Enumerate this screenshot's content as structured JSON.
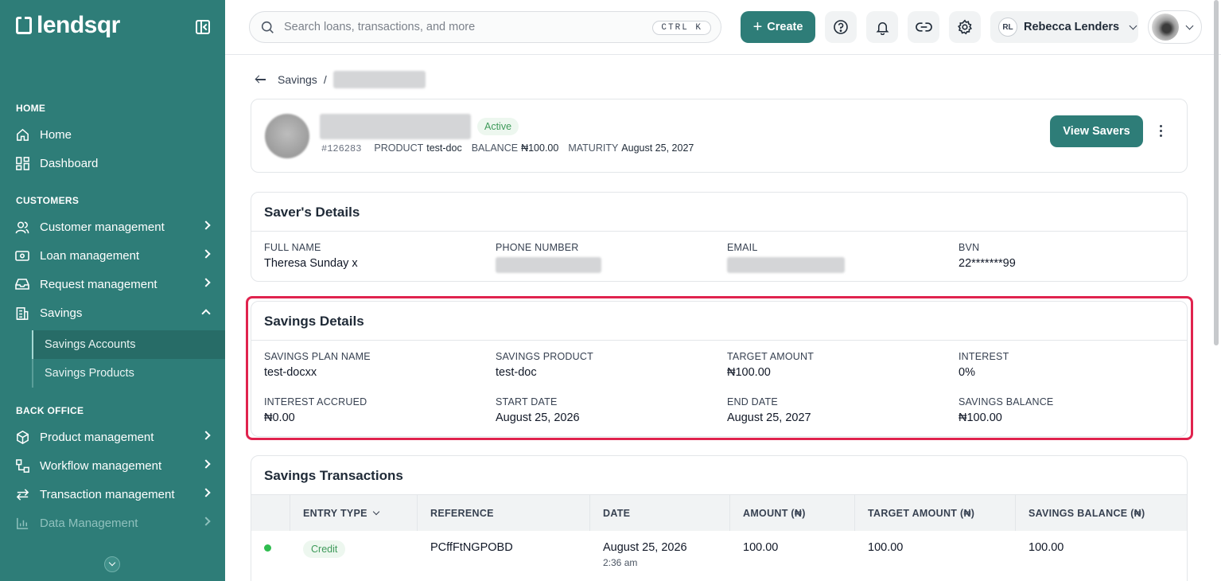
{
  "app": {
    "logo_text": "lendsqr"
  },
  "sidebar": {
    "sections": [
      {
        "title": "HOME"
      },
      {
        "title": "CUSTOMERS"
      },
      {
        "title": "BACK OFFICE"
      }
    ],
    "items": [
      {
        "label": "Home",
        "icon": "home-icon"
      },
      {
        "label": "Dashboard",
        "icon": "dashboard-icon"
      },
      {
        "label": "Customer management",
        "icon": "users-icon"
      },
      {
        "label": "Loan management",
        "icon": "loan-icon"
      },
      {
        "label": "Request management",
        "icon": "inbox-icon"
      },
      {
        "label": "Savings",
        "icon": "savings-icon"
      },
      {
        "label": "Product management",
        "icon": "box-icon"
      },
      {
        "label": "Workflow management",
        "icon": "workflow-icon"
      },
      {
        "label": "Transaction management",
        "icon": "transfer-icon"
      },
      {
        "label": "Data Management",
        "icon": "chart-icon"
      }
    ],
    "sub_items": [
      {
        "label": "Savings Accounts",
        "active": true
      },
      {
        "label": "Savings Products",
        "active": false
      }
    ]
  },
  "topbar": {
    "search_placeholder": "Search loans, transactions, and more",
    "shortcut": "CTRL K",
    "create_label": "Create",
    "user_initials": "RL",
    "user_name": "Rebecca Lenders"
  },
  "breadcrumb": {
    "parent": "Savings",
    "separator": "/"
  },
  "saver": {
    "status": "Active",
    "id": "#126283",
    "product_label": "PRODUCT",
    "product": "test-doc",
    "balance_label": "BALANCE",
    "balance": "₦100.00",
    "maturity_label": "MATURITY",
    "maturity": "August 25, 2027",
    "view_button": "View Savers"
  },
  "savers_details": {
    "title": "Saver's Details",
    "fields": [
      {
        "label": "FULL NAME",
        "value": "Theresa Sunday x"
      },
      {
        "label": "PHONE NUMBER",
        "value": ""
      },
      {
        "label": "EMAIL",
        "value": ""
      },
      {
        "label": "BVN",
        "value": "22*******99"
      }
    ]
  },
  "savings_details": {
    "title": "Savings Details",
    "fields": [
      {
        "label": "SAVINGS PLAN NAME",
        "value": "test-docxx"
      },
      {
        "label": "SAVINGS PRODUCT",
        "value": "test-doc"
      },
      {
        "label": "TARGET AMOUNT",
        "value": "₦100.00"
      },
      {
        "label": "INTEREST",
        "value": "0%"
      },
      {
        "label": "INTEREST ACCRUED",
        "value": "₦0.00"
      },
      {
        "label": "START DATE",
        "value": "August 25, 2026"
      },
      {
        "label": "END DATE",
        "value": "August 25, 2027"
      },
      {
        "label": "SAVINGS BALANCE",
        "value": "₦100.00"
      }
    ]
  },
  "transactions": {
    "title": "Savings Transactions",
    "columns": [
      "ENTRY TYPE",
      "REFERENCE",
      "DATE",
      "AMOUNT (₦)",
      "TARGET AMOUNT (₦)",
      "SAVINGS BALANCE (₦)"
    ],
    "rows": [
      {
        "entry_type": "Credit",
        "reference": "PCffFtNGPOBD",
        "date": "August 25, 2026",
        "time": "2:36 am",
        "amount": "100.00",
        "target_amount": "100.00",
        "savings_balance": "100.00"
      }
    ]
  },
  "colors": {
    "brand": "#2e7d78",
    "highlight": "#e0234e",
    "success": "#2fbd4f"
  }
}
